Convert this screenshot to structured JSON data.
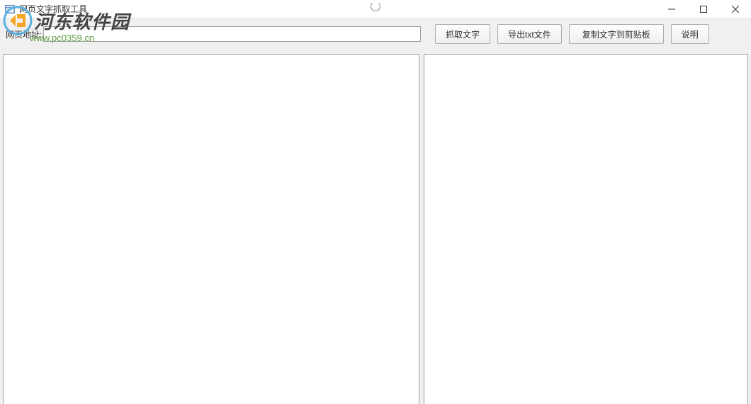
{
  "window": {
    "title": "网页文字抓取工具"
  },
  "toolbar": {
    "url_label": "网页地址:",
    "url_value": "",
    "buttons": {
      "grab": "抓取文字",
      "export": "导出txt文件",
      "copy": "复制文字到剪贴板",
      "help": "说明"
    }
  },
  "watermark": {
    "brand": "河东软件园",
    "url": "www.pc0359.cn"
  }
}
